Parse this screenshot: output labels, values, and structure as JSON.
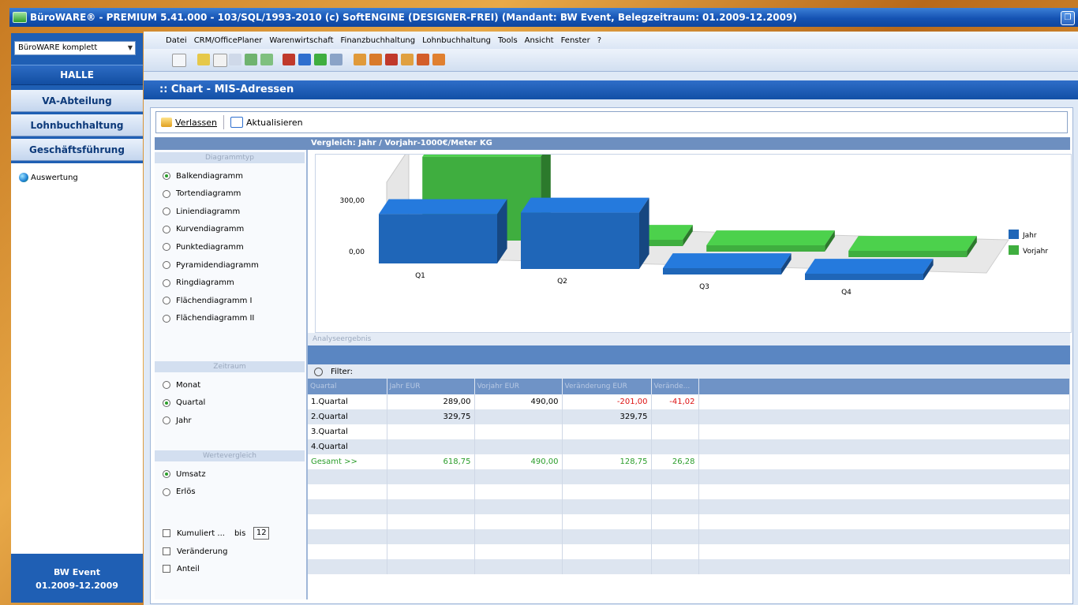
{
  "window": {
    "title": "BüroWARE® - PREMIUM  5.41.000 - 103/SQL/1993-2010 (c) SoftENGINE (DESIGNER-FREI)  (Mandant: BW Event, Belegzeitraum: 01.2009-12.2009)",
    "restore_glyph": "❐"
  },
  "sidebar": {
    "combo_value": "BüroWARE komplett",
    "halle": "HALLE",
    "nav": [
      "VA-Abteilung",
      "Lohnbuchhaltung",
      "Geschäftsführung"
    ],
    "tree_item": "Auswertung",
    "footer_line1": "BW Event",
    "footer_line2": "01.2009-12.2009"
  },
  "menu": [
    "Datei",
    "CRM/OfficePlaner",
    "Warenwirtschaft",
    "Finanzbuchhaltung",
    "Lohnbuchhaltung",
    "Tools",
    "Ansicht",
    "Fenster",
    "?"
  ],
  "chart_window_title": ":: Chart - MIS-Adressen",
  "actions": {
    "leave": "Verlassen",
    "refresh": "Aktualisieren"
  },
  "comparison_title": "Vergleich: Jahr / Vorjahr-1000€/Meter KG",
  "options": {
    "diagramtype_header": "Diagrammtyp",
    "diagramtypes": [
      "Balkendiagramm",
      "Tortendiagramm",
      "Liniendiagramm",
      "Kurvendiagramm",
      "Punktediagramm",
      "Pyramidendiagramm",
      "Ringdiagramm",
      "Flächendiagramm I",
      "Flächendiagramm II"
    ],
    "diagramtype_selected": 0,
    "period_header": "Zeitraum",
    "periods": [
      "Monat",
      "Quartal",
      "Jahr"
    ],
    "period_selected": 1,
    "value_header": "Wertevergleich",
    "values": [
      "Umsatz",
      "Erlös"
    ],
    "value_selected": 0,
    "checks": [
      "Kumuliert ...",
      "Veränderung",
      "Anteil"
    ],
    "bis_label": "bis",
    "bis_value": "12"
  },
  "chart_data": {
    "type": "bar",
    "categories": [
      "Q1",
      "Q2",
      "Q3",
      "Q4"
    ],
    "series": [
      {
        "name": "Jahr",
        "values": [
          289.0,
          329.75,
          0,
          0
        ],
        "color": "#1f66b8"
      },
      {
        "name": "Vorjahr",
        "values": [
          490.0,
          0,
          0,
          0
        ],
        "color": "#3fae3f"
      }
    ],
    "yticks": [
      "0,00",
      "300,00"
    ],
    "ylim": [
      0,
      600
    ],
    "grid": false,
    "legend_position": "right"
  },
  "analysis": {
    "header": "Analyseergebnis",
    "filter_label": "Filter:",
    "columns": [
      "Quartal",
      "Jahr EUR",
      "Vorjahr EUR",
      "Veränderung EUR",
      "Verände..."
    ],
    "rows": [
      {
        "c0": "1.Quartal",
        "c1": "289,00",
        "c2": "490,00",
        "c3": "-201,00",
        "c4": "-41,02"
      },
      {
        "c0": "2.Quartal",
        "c1": "329,75",
        "c2": "",
        "c3": "329,75",
        "c4": ""
      },
      {
        "c0": "3.Quartal",
        "c1": "",
        "c2": "",
        "c3": "",
        "c4": ""
      },
      {
        "c0": "4.Quartal",
        "c1": "",
        "c2": "",
        "c3": "",
        "c4": ""
      },
      {
        "c0": "Gesamt >>",
        "c1": "618,75",
        "c2": "490,00",
        "c3": "128,75",
        "c4": "26,28"
      }
    ]
  }
}
